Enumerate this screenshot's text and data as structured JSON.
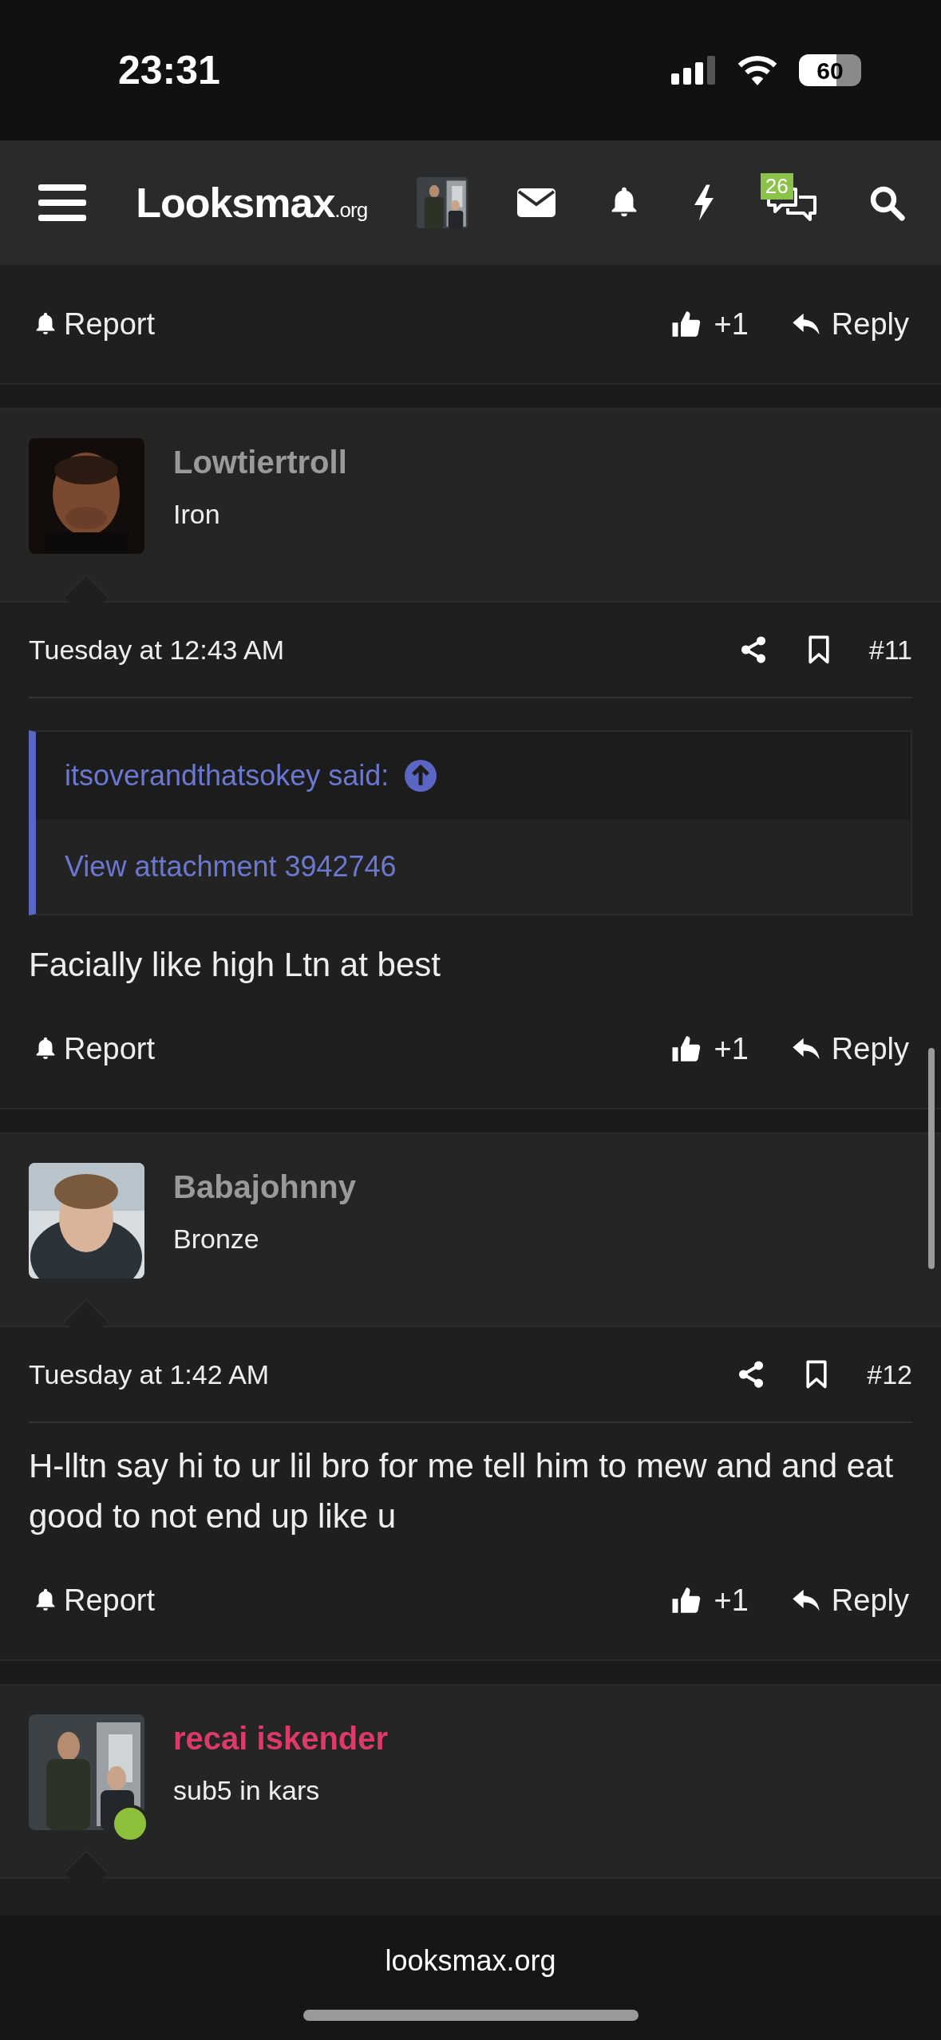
{
  "status_bar": {
    "time": "23:31",
    "battery": "60"
  },
  "nav": {
    "logo": "Looksmax",
    "logo_suffix": ".org",
    "badge": "26"
  },
  "top_actions": {
    "report": "Report",
    "likes": "+1",
    "reply": "Reply"
  },
  "posts": [
    {
      "user": "Lowtiertroll",
      "color": "#9a9a9a",
      "title": "Iron",
      "online": false,
      "date": "Tuesday at 12:43 AM",
      "number": "#11",
      "quote": {
        "author": "itsoverandthatsokey said:",
        "content": "View attachment 3942746"
      },
      "body": "Facially like high Ltn at best",
      "actions": {
        "report": "Report",
        "likes": "+1",
        "reply": "Reply"
      }
    },
    {
      "user": "Babajohnny",
      "color": "#9a9a9a",
      "title": "Bronze",
      "online": false,
      "date": "Tuesday at 1:42 AM",
      "number": "#12",
      "body": "H-lltn say hi to ur lil bro for me tell him to mew and and eat good to not end up like u",
      "actions": {
        "report": "Report",
        "likes": "+1",
        "reply": "Reply"
      }
    },
    {
      "user": "recai iskender",
      "color": "#dc3a68",
      "title": "sub5 in kars",
      "online": true
    }
  ],
  "footer": {
    "url": "looksmax.org"
  }
}
